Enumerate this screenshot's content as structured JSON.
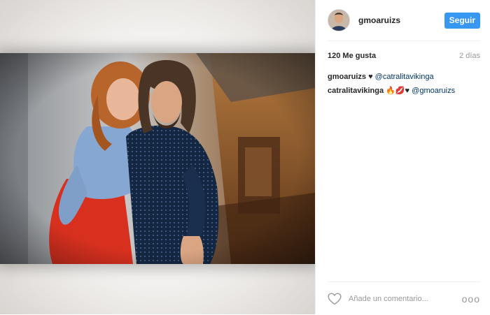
{
  "post": {
    "header": {
      "username": "gmoaruizs",
      "follow_label": "Seguir"
    },
    "stats": {
      "likes": "120 Me gusta",
      "time": "2 días"
    },
    "comments": [
      {
        "user": "gmoaruizs",
        "emoji": "♥",
        "mention": "@catralitavikinga"
      },
      {
        "user": "catralitavikinga",
        "emoji": "🔥💋♥",
        "mention": "@gmoaruizs"
      }
    ],
    "footer": {
      "comment_placeholder": "Añade un comentario...",
      "more_label": "ooo"
    },
    "colors": {
      "follow_button": "#3897f0",
      "mention": "#003569",
      "muted": "#999999"
    },
    "icons": [
      "heart-icon",
      "more-options-icon"
    ]
  }
}
